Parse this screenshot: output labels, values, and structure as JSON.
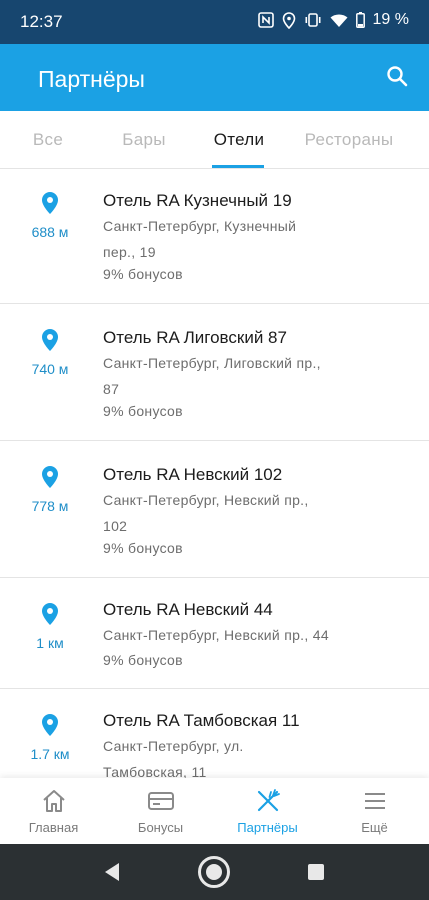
{
  "status_bar": {
    "time": "12:37",
    "battery_percent": "19 %",
    "icons": [
      "nfc-icon",
      "location-icon",
      "vibrate-icon",
      "wifi-icon",
      "battery-icon"
    ]
  },
  "app_bar": {
    "title": "Партнёры",
    "search_icon": "search-icon"
  },
  "tabs": [
    {
      "label": "Все",
      "active": false
    },
    {
      "label": "Бары",
      "active": false
    },
    {
      "label": "Отели",
      "active": true
    },
    {
      "label": "Рестораны",
      "active": false
    }
  ],
  "partners": [
    {
      "distance": "688 м",
      "name": "Отель RA Кузнечный 19",
      "address_lines": [
        "Санкт-Петербург, Кузнечный",
        "пер., 19"
      ],
      "bonus": "9% бонусов"
    },
    {
      "distance": "740 м",
      "name": "Отель RA Лиговский 87",
      "address_lines": [
        "Санкт-Петербург, Лиговский пр.,",
        "87"
      ],
      "bonus": "9% бонусов"
    },
    {
      "distance": "778 м",
      "name": "Отель RA Невский 102",
      "address_lines": [
        "Санкт-Петербург, Невский пр.,",
        "102"
      ],
      "bonus": "9% бонусов"
    },
    {
      "distance": "1 км",
      "name": "Отель RA Невский 44",
      "address_lines": [
        "Санкт-Петербург, Невский пр., 44"
      ],
      "bonus": "9% бонусов"
    },
    {
      "distance": "1.7 км",
      "name": "Отель RA Тамбовская 11",
      "address_lines": [
        "Санкт-Петербург, ул.",
        "Тамбовская, 11"
      ],
      "bonus": ""
    }
  ],
  "bottom_nav": [
    {
      "label": "Главная",
      "icon": "home-icon",
      "active": false
    },
    {
      "label": "Бонусы",
      "icon": "card-icon",
      "active": false
    },
    {
      "label": "Партнёры",
      "icon": "fork-knife-icon",
      "active": true
    },
    {
      "label": "Ещё",
      "icon": "menu-icon",
      "active": false
    }
  ],
  "system_nav": [
    "back-icon",
    "home-circle-icon",
    "recents-icon"
  ],
  "colors": {
    "status_bar": "#17466f",
    "accent": "#1ba1e4",
    "distance_text": "#1f8ec8",
    "system_nav": "#2b3033"
  }
}
